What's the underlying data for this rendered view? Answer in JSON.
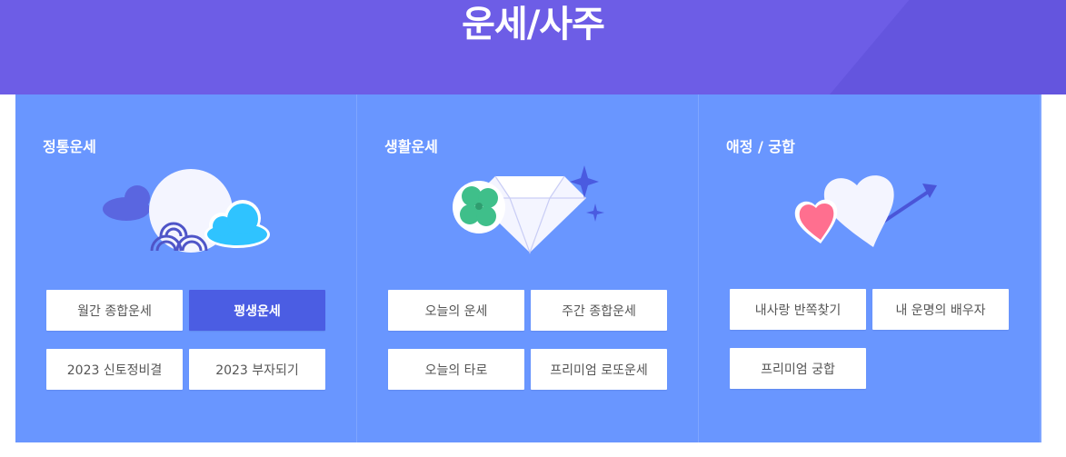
{
  "header": {
    "title": "운세/사주"
  },
  "colors": {
    "header_bg": "#6d5de6",
    "panel_bg": "#6996ff",
    "active_button": "#4b5de3"
  },
  "columns": [
    {
      "title": "정통운세",
      "icon": "moon-cloud-illustration",
      "buttons": [
        {
          "label": "월간 종합운세",
          "active": false
        },
        {
          "label": "평생운세",
          "active": true
        },
        {
          "label": "2023 신토정비결",
          "active": false
        },
        {
          "label": "2023 부자되기",
          "active": false
        }
      ]
    },
    {
      "title": "생활운세",
      "icon": "clover-diamond-illustration",
      "buttons": [
        {
          "label": "오늘의 운세",
          "active": false
        },
        {
          "label": "주간 종합운세",
          "active": false
        },
        {
          "label": "오늘의 타로",
          "active": false
        },
        {
          "label": "프리미엄 로또운세",
          "active": false
        }
      ]
    },
    {
      "title": "애정 / 궁합",
      "icon": "hearts-arrow-illustration",
      "buttons": [
        {
          "label": "내사랑 반쪽찾기",
          "active": false
        },
        {
          "label": "내 운명의 배우자",
          "active": false
        },
        {
          "label": "프리미엄 궁합",
          "active": false
        }
      ]
    }
  ]
}
